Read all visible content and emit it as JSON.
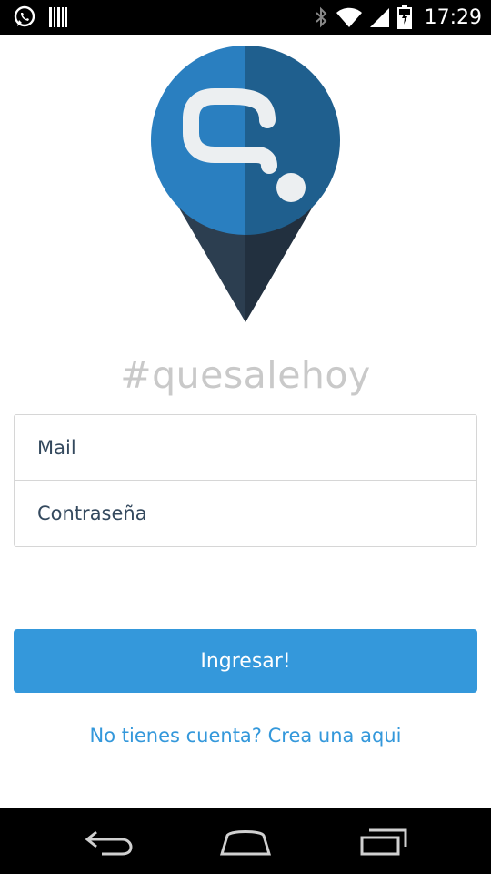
{
  "status_bar": {
    "time": "17:29",
    "left_icons": [
      "whatsapp-icon",
      "barcode-notification-icon"
    ],
    "right_icons": [
      "bluetooth-icon",
      "wifi-icon",
      "cell-signal-icon",
      "battery-charging-icon"
    ]
  },
  "app": {
    "logo_colors": {
      "left": "#2a7fc0",
      "right": "#1f5f8e",
      "tip_left": "#2c3e50",
      "tip_right": "#22303f"
    },
    "name": "#quesalehoy"
  },
  "form": {
    "mail_placeholder": "Mail",
    "password_placeholder": "Contraseña",
    "submit_label": "Ingresar!",
    "signup_link": "No tienes cuenta? Crea una aqui"
  },
  "colors": {
    "accent": "#3498db",
    "text": "#34495e",
    "muted": "#c9c9c9"
  },
  "nav_bar": {
    "icons": [
      "back-icon",
      "home-icon",
      "recent-apps-icon"
    ]
  }
}
